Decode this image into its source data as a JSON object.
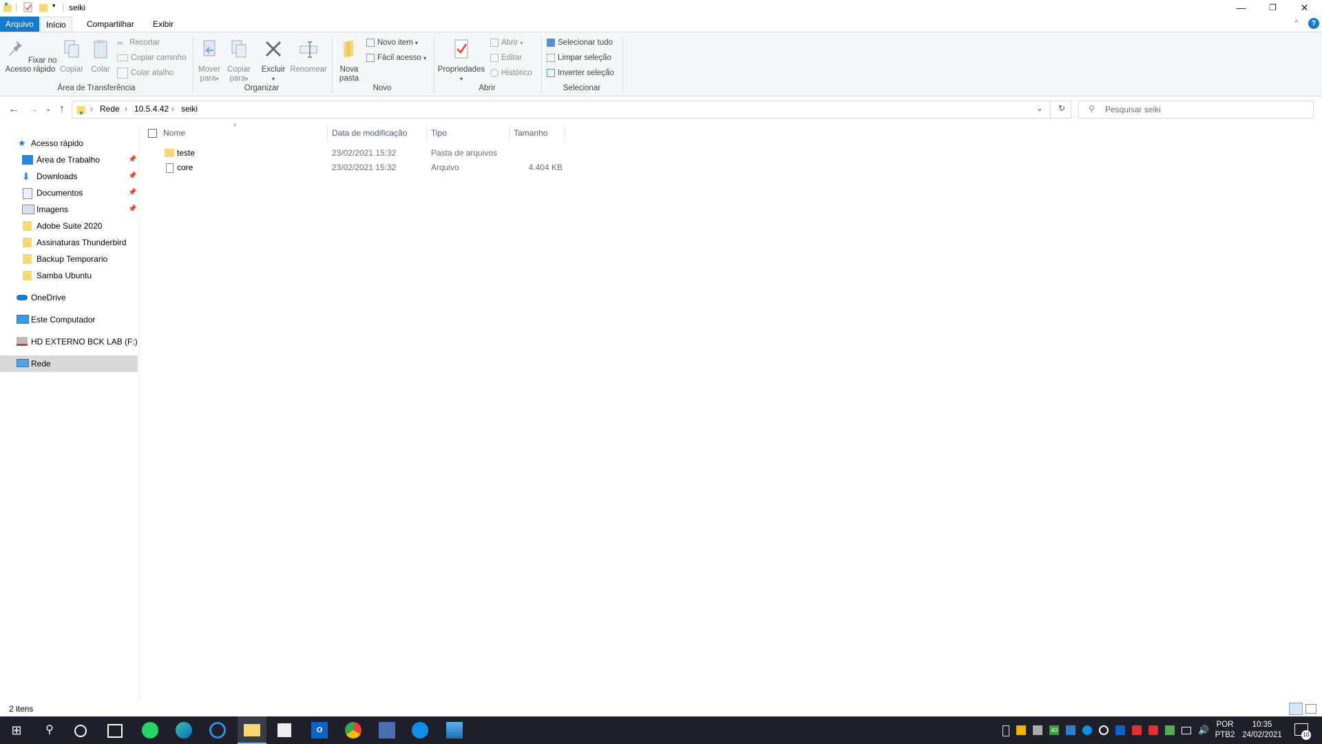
{
  "window": {
    "title": "seiki",
    "minimize_icon": "minimize-icon",
    "restore_icon": "restore-icon",
    "close_icon": "close-icon"
  },
  "ribbon_tabs": {
    "file": "Arquivo",
    "home": "Início",
    "share": "Compartilhar",
    "view": "Exibir"
  },
  "ribbon": {
    "clipboard": {
      "pin": "Fixar no\nAcesso rápido",
      "copy": "Copiar",
      "paste": "Colar",
      "cut": "Recortar",
      "copy_path": "Copiar caminho",
      "paste_shortcut": "Colar atalho",
      "label": "Área de Transferência"
    },
    "organize": {
      "move_to": "Mover\npara",
      "copy_to": "Copiar\npara",
      "delete": "Excluir",
      "rename": "Renomear",
      "label": "Organizar"
    },
    "new": {
      "new_folder": "Nova\npasta",
      "new_item": "Novo item",
      "easy_access": "Fácil acesso",
      "label": "Novo"
    },
    "open": {
      "properties": "Propriedades",
      "open": "Abrir",
      "edit": "Editar",
      "history": "Histórico",
      "label": "Abrir"
    },
    "select": {
      "select_all": "Selecionar tudo",
      "select_none": "Limpar seleção",
      "invert": "Inverter seleção",
      "label": "Selecionar"
    }
  },
  "address": {
    "crumbs": [
      "Rede",
      "10.5.4.42",
      "seiki"
    ],
    "search_placeholder": "Pesquisar seiki"
  },
  "nav": {
    "quick_access": "Acesso rápido",
    "quick_items": [
      {
        "label": "Área de Trabalho",
        "icon": "desktop-icon",
        "pinned": true
      },
      {
        "label": "Downloads",
        "icon": "download-icon",
        "pinned": true
      },
      {
        "label": "Documentos",
        "icon": "documents-icon",
        "pinned": true
      },
      {
        "label": "Imagens",
        "icon": "pictures-icon",
        "pinned": true
      },
      {
        "label": "Adobe Suite 2020",
        "icon": "folder-icon",
        "pinned": false
      },
      {
        "label": "Assinaturas Thunderbird",
        "icon": "folder-icon",
        "pinned": false
      },
      {
        "label": "Backup Temporario",
        "icon": "folder-icon",
        "pinned": false
      },
      {
        "label": "Samba Ubuntu",
        "icon": "folder-icon",
        "pinned": false
      }
    ],
    "onedrive": "OneDrive",
    "this_pc": "Este Computador",
    "external_drive": "HD EXTERNO BCK LAB (F:)",
    "network": "Rede"
  },
  "columns": {
    "name": "Nome",
    "date": "Data de modificação",
    "type": "Tipo",
    "size": "Tamanho"
  },
  "files": [
    {
      "name": "teste",
      "date": "23/02/2021 15:32",
      "type": "Pasta de arquivos",
      "size": "",
      "icon": "folder-icon"
    },
    {
      "name": "core",
      "date": "23/02/2021 15:32",
      "type": "Arquivo",
      "size": "4.404 KB",
      "icon": "file-icon"
    }
  ],
  "status": {
    "count": "2 itens"
  },
  "taskbar": {
    "lang_top": "POR",
    "lang_bottom": "PTB2",
    "time": "10:35",
    "date": "24/02/2021",
    "notification_count": "10",
    "tray_badge": "40"
  },
  "colors": {
    "accent": "#1979ca",
    "taskbar": "#1e1f29",
    "folder": "#f8d775"
  }
}
